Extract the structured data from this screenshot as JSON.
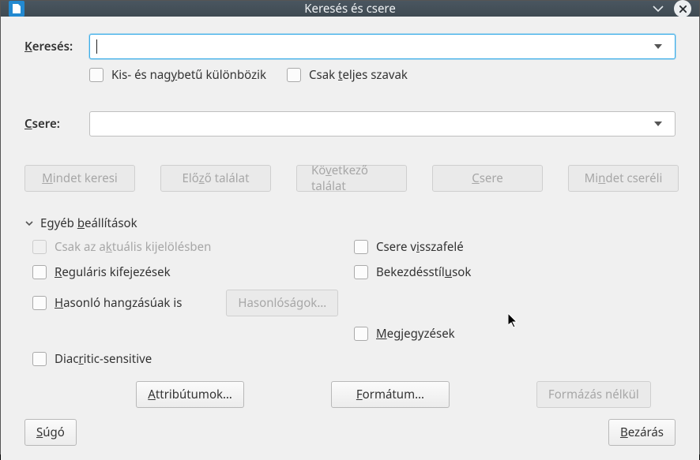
{
  "titlebar": {
    "title": "Keresés és csere"
  },
  "search": {
    "label_pre": "K",
    "label_rest": "eresés:",
    "value": "",
    "match_case_pre": "Kis- és nag",
    "match_case_u": "y",
    "match_case_post": "betű különbözik",
    "whole_words_pre": "Csak ",
    "whole_words_u": "t",
    "whole_words_post": "eljes szavak"
  },
  "replace": {
    "label_pre": "C",
    "label_rest": "sere:",
    "value": ""
  },
  "buttons": {
    "find_all_pre": "M",
    "find_all_rest": "indet keresi",
    "prev_pre": "Elő",
    "prev_u": "z",
    "prev_post": "ő találat",
    "next_pre": "Kö",
    "next_u": "v",
    "next_post": "etkező találat",
    "replace_pre": "C",
    "replace_rest": "sere",
    "replace_all_pre": "Mi",
    "replace_all_u": "n",
    "replace_all_post": "det cseréli"
  },
  "other": {
    "header_pre": "Egyéb ",
    "header_u": "b",
    "header_post": "eállítások",
    "selection_pre": "Csak az a",
    "selection_u": "k",
    "selection_post": "tuális kijelölésben",
    "regex_pre": "R",
    "regex_rest": "eguláris kifejezések",
    "similar_pre": "H",
    "similar_rest": "asonló hangzásúak is",
    "similar_btn": "Hasonlóságok…",
    "backwards_pre": "Csere v",
    "backwards_u": "i",
    "backwards_post": "sszafelé",
    "para_pre": "Bekezdésstíl",
    "para_u": "u",
    "para_post": "sok",
    "comments_pre": "M",
    "comments_rest": "egjegyzések",
    "diacritic_pre": "Diac",
    "diacritic_u": "r",
    "diacritic_post": "itic-sensitive"
  },
  "attr": {
    "attributes_pre": "A",
    "attributes_rest": "ttribútumok…",
    "format_pre": "F",
    "format_rest": "ormátum…",
    "noformat": "Formázás nélkül"
  },
  "footer": {
    "help_pre": "S",
    "help_rest": "úgó",
    "close_pre": "B",
    "close_rest": "ezárás"
  }
}
